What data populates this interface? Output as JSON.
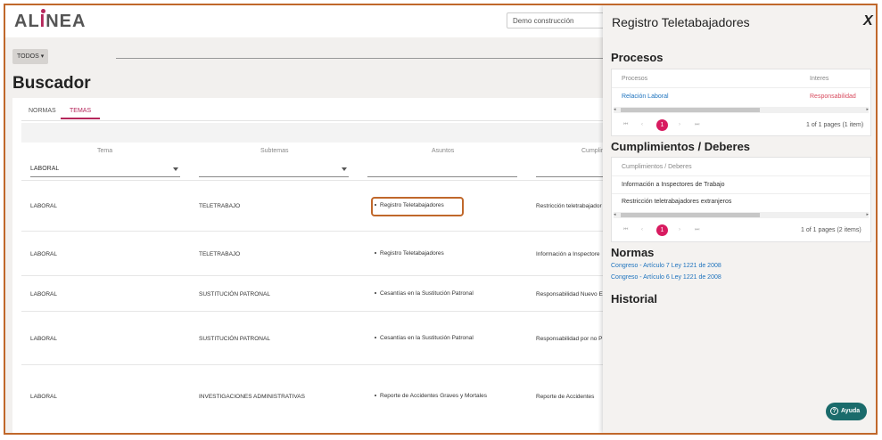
{
  "header": {
    "logo": {
      "prefix": "AL",
      "accent": "I",
      "suffix": "NEA"
    },
    "company_select": {
      "value": "Demo construcción",
      "options_visible": [
        "Demo construcción"
      ]
    },
    "todos_label": "TODOS",
    "page_title": "Buscador"
  },
  "tabs": [
    {
      "label": "NORMAS",
      "active": false
    },
    {
      "label": "TEMAS",
      "active": true
    }
  ],
  "table": {
    "columns": [
      "Tema",
      "Subtemas",
      "Asuntos",
      "Cumplim"
    ],
    "filters": {
      "tema": "LABORAL",
      "subtemas": "",
      "asuntos": "",
      "cumplim": ""
    },
    "rows": [
      {
        "tema": "LABORAL",
        "subtema": "TELETRABAJO",
        "asunto": "Registro Teletabajadores",
        "cumpl": "Restricción teletrabajador"
      },
      {
        "tema": "LABORAL",
        "subtema": "TELETRABAJO",
        "asunto": "Registro Teletabajadores",
        "cumpl": "Información a Inspectore"
      },
      {
        "tema": "LABORAL",
        "subtema": "SUSTITUCIÓN PATRONAL",
        "asunto": "Cesantías en la Sustitución Patronal",
        "cumpl": "Responsabilidad Nuevo E"
      },
      {
        "tema": "LABORAL",
        "subtema": "SUSTITUCIÓN PATRONAL",
        "asunto": "Cesantías en la Sustitución Patronal",
        "cumpl": "Responsabilidad por no P"
      },
      {
        "tema": "LABORAL",
        "subtema": "INVESTIGACIONES ADMINISTRATIVAS",
        "asunto": "Reporte de Accidentes Graves y Mortales",
        "cumpl": "Reporte de Accidentes"
      }
    ]
  },
  "panel": {
    "title": "Registro Teletabajadores",
    "close_label": "X",
    "procesos": {
      "heading": "Procesos",
      "columns": [
        "Procesos",
        "Interes"
      ],
      "rows": [
        {
          "proceso": "Relación Laboral",
          "interes": "Responsabilidad"
        }
      ],
      "page": "1",
      "page_info": "1 of 1 pages (1 item)"
    },
    "cumplimientos": {
      "heading": "Cumplimientos / Deberes",
      "column": "Cumplimientos / Deberes",
      "rows": [
        "Información a Inspectores de Trabajo",
        "Restricción teletrabajadores extranjeros"
      ],
      "page": "1",
      "page_info": "1 of 1 pages (2 items)"
    },
    "normas": {
      "heading": "Normas",
      "links": [
        "Congreso - Artículo 7 Ley 1221 de 2008",
        "Congreso - Artículo 6 Ley 1221 de 2008"
      ]
    },
    "historial_heading": "Historial"
  },
  "help_button": "Ayuda",
  "colors": {
    "accent": "#b5275b",
    "pager": "#d81b60",
    "link": "#1e73be",
    "highlight_border": "#c0682b",
    "help": "#1a6b6b"
  }
}
